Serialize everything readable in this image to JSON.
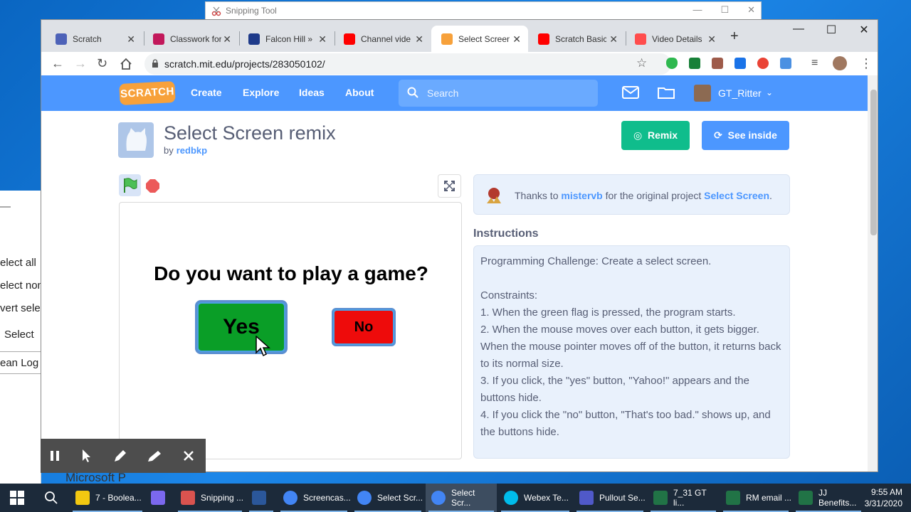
{
  "snipping_tool": {
    "title": "Snipping Tool"
  },
  "left_window": {
    "items": [
      "elect all",
      "elect non",
      "vert sele",
      "Select",
      "ean Log"
    ]
  },
  "browser": {
    "tabs": [
      {
        "label": "Scratch",
        "color": "#4d62b8"
      },
      {
        "label": "Classwork for",
        "color": "#c2185b"
      },
      {
        "label": "Falcon Hill »",
        "color": "#1e3a8a"
      },
      {
        "label": "Channel vide",
        "color": "#ff0000"
      },
      {
        "label": "Select Screen",
        "color": "#f7a13b"
      },
      {
        "label": "Scratch Basic",
        "color": "#ff0000"
      },
      {
        "label": "Video Details",
        "color": "#ff4d4d"
      }
    ],
    "url": "scratch.mit.edu/projects/283050102/"
  },
  "scratch": {
    "logo": "SCRATCH",
    "nav": [
      "Create",
      "Explore",
      "Ideas",
      "About"
    ],
    "search_placeholder": "Search",
    "username": "GT_Ritter",
    "project": {
      "title": "Select Screen remix",
      "by": "by",
      "author": "redbkp",
      "remix": "Remix",
      "see_inside": "See inside"
    },
    "stage": {
      "question": "Do you want to play a game?",
      "yes": "Yes",
      "no": "No"
    },
    "credit": {
      "prefix": "Thanks to",
      "user": "mistervb",
      "middle": "for the original project",
      "project": "Select Screen",
      "suffix": "."
    },
    "instructions_heading": "Instructions",
    "instructions": [
      "Programming Challenge: Create a select screen.",
      "",
      "Constraints:",
      "1. When the green flag is pressed, the program starts.",
      "2. When the mouse moves over each button, it gets bigger. When the mouse pointer moves off of the button, it returns back to its normal size.",
      "3. If you click, the \"yes\" button, \"Yahoo!\" appears and the buttons hide.",
      "4. If you click the \"no\" button, \"That's too bad.\" shows up, and the buttons hide."
    ]
  },
  "background_text": "Microsoft P",
  "taskbar": {
    "items": [
      {
        "label": "7 - Boolea...",
        "color": "#f2c811"
      },
      {
        "label": "",
        "color": "#7b68ee"
      },
      {
        "label": "Snipping ...",
        "color": "#d9534f"
      },
      {
        "label": "",
        "color": "#2b579a"
      },
      {
        "label": "Screencas...",
        "color": "#4285f4"
      },
      {
        "label": "Select Scr...",
        "color": "#4285f4"
      },
      {
        "label": "Select Scr...",
        "color": "#4285f4"
      },
      {
        "label": "Webex Te...",
        "color": "#00bceb"
      },
      {
        "label": "Pullout Se...",
        "color": "#5059c9"
      },
      {
        "label": "7_31 GT li...",
        "color": "#217346"
      },
      {
        "label": "RM email ...",
        "color": "#217346"
      },
      {
        "label": "JJ Benefits...",
        "color": "#217346"
      }
    ],
    "time": "9:55 AM",
    "date": "3/31/2020"
  }
}
